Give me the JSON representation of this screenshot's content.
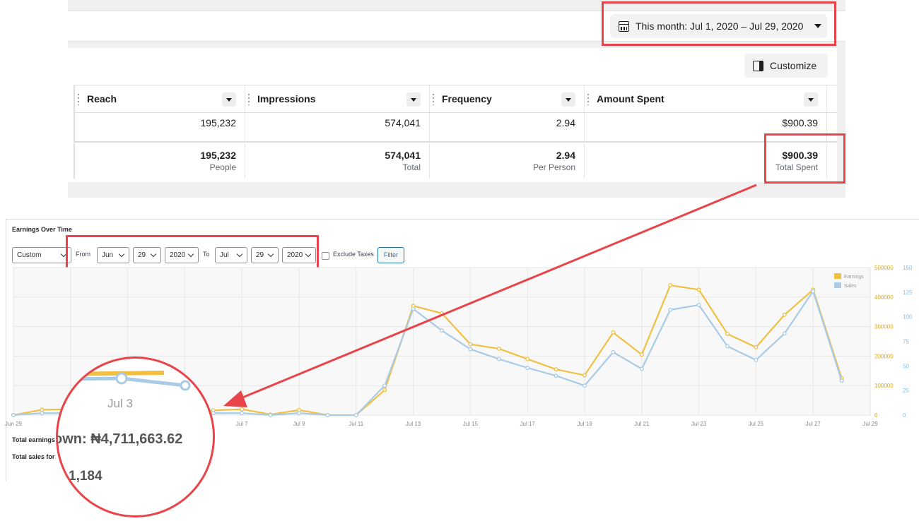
{
  "header": {
    "date_range_label": "This month: Jul 1, 2020 – Jul 29, 2020",
    "customize_label": "Customize"
  },
  "ads_table": {
    "columns": [
      {
        "label": "Reach",
        "value": "195,232",
        "total": "195,232",
        "sub": "People"
      },
      {
        "label": "Impressions",
        "value": "574,041",
        "total": "574,041",
        "sub": "Total"
      },
      {
        "label": "Frequency",
        "value": "2.94",
        "total": "2.94",
        "sub": "Per Person"
      },
      {
        "label": "Amount Spent",
        "value": "$900.39",
        "total": "$900.39",
        "sub": "Total Spent"
      }
    ]
  },
  "report": {
    "title": "Earnings Over Time",
    "range_select": "Custom",
    "from_label": "From",
    "from_month": "Jun",
    "from_day": "29",
    "from_year": "2020",
    "to_label": "To",
    "to_month": "Jul",
    "to_day": "29",
    "to_year": "2020",
    "exclude_taxes_label": "Exclude Taxes",
    "filter_label": "Filter",
    "total_earnings_label": "Total earnings",
    "total_sales_label": "Total sales for"
  },
  "callout": {
    "axis_label": "Jul 3",
    "earnings_text": "own: ₦4,711,663.62",
    "sales_text": "1,184"
  },
  "colors": {
    "highlight": "#e8444a",
    "earnings": "#f0c043",
    "sales": "#a9cbe6"
  },
  "chart_data": {
    "type": "line",
    "x": [
      "Jun 29",
      "Jun 30",
      "Jul 1",
      "Jul 2",
      "Jul 3",
      "Jul 4",
      "Jul 5",
      "Jul 6",
      "Jul 7",
      "Jul 8",
      "Jul 9",
      "Jul 10",
      "Jul 11",
      "Jul 12",
      "Jul 13",
      "Jul 14",
      "Jul 15",
      "Jul 16",
      "Jul 17",
      "Jul 18",
      "Jul 19",
      "Jul 20",
      "Jul 21",
      "Jul 22",
      "Jul 23",
      "Jul 24",
      "Jul 25",
      "Jul 26",
      "Jul 27",
      "Jul 28",
      "Jul 29"
    ],
    "x_tick_labels": [
      "Jun 29",
      "Jul 1",
      "Jul 3",
      "Jul 5",
      "Jul 7",
      "Jul 9",
      "Jul 11",
      "Jul 13",
      "Jul 15",
      "Jul 17",
      "Jul 19",
      "Jul 21",
      "Jul 23",
      "Jul 25",
      "Jul 27",
      "Jul 29"
    ],
    "series": [
      {
        "name": "Earnings",
        "axis": "left",
        "values": [
          0,
          18000,
          20000,
          22000,
          20000,
          2000,
          0,
          16000,
          20000,
          2000,
          17000,
          0,
          0,
          85000,
          370000,
          345000,
          240000,
          225000,
          190000,
          155000,
          135000,
          280000,
          205000,
          440000,
          425000,
          275000,
          230000,
          340000,
          425000,
          125000,
          null
        ]
      },
      {
        "name": "Sales",
        "axis": "right",
        "values": [
          0,
          2,
          2,
          2,
          2,
          0,
          0,
          2,
          2,
          0,
          2,
          0,
          0,
          30,
          108,
          86,
          67,
          57,
          48,
          40,
          30,
          64,
          47,
          107,
          112,
          70,
          56,
          83,
          126,
          35,
          null
        ]
      }
    ],
    "y_left_ticks": [
      0,
      100000,
      200000,
      300000,
      400000,
      500000
    ],
    "y_right_ticks": [
      0,
      25,
      50,
      75,
      100,
      125,
      150
    ],
    "y_left_range": [
      0,
      500000
    ],
    "y_right_range": [
      0,
      150
    ],
    "legend": [
      "Earnings",
      "Sales"
    ],
    "legend_position": "top-right",
    "grid": true
  }
}
